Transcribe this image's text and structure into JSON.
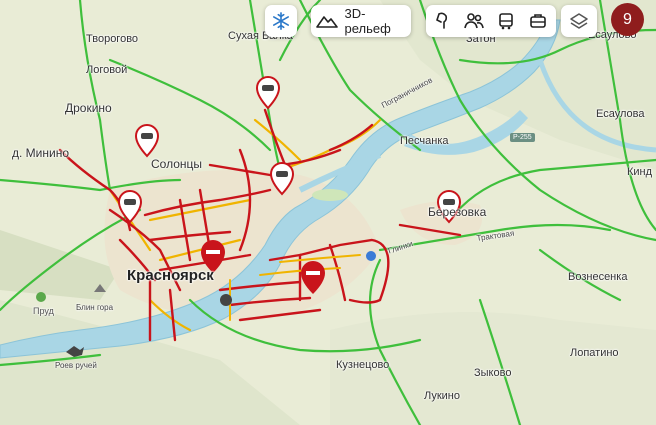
{
  "toolbar": {
    "relief_label": "3D-рельеф",
    "notification_count": "9"
  },
  "icons": {
    "winter": "snowflake-icon",
    "relief": "mountain-icon",
    "panorama": "person-icon",
    "people": "people-icon",
    "transit": "bus-icon",
    "business": "briefcase-icon",
    "layers": "layers-icon"
  },
  "places": {
    "tvorogovo": "Творогово",
    "sukhaya_balka": "Сухая Балка",
    "logovoy": "Логовой",
    "drokino": "Дрокино",
    "minino": "д. Минино",
    "solontsy": "Солонцы",
    "krasnoyarsk": "Красноярск",
    "prud": "Пруд",
    "blin_gora": "Блин гора",
    "roev_ruchey": "Роев ручей",
    "zaton": "Затон",
    "esaulovo_top": "Есаулово",
    "esaulovo": "Есаулова",
    "peschanka": "Песчанка",
    "berezovka": "Березовка",
    "kindya": "Кинд",
    "voznesenka": "Вознесенка",
    "kuznetsovo": "Кузнецово",
    "zykovo": "Зыково",
    "lopatino": "Лопатино",
    "lukino": "Лукино",
    "street_pogranichnikov": "Пограничников",
    "street_glinki": "Глинки",
    "street_traktovaya": "Трактовая",
    "road_r255": "Р-255"
  },
  "colors": {
    "jam_red": "#c9141b",
    "slow_yellow": "#f0b400",
    "free_green": "#3fbf3c",
    "river": "#a9d6e5",
    "badge": "#8f1d1d"
  }
}
